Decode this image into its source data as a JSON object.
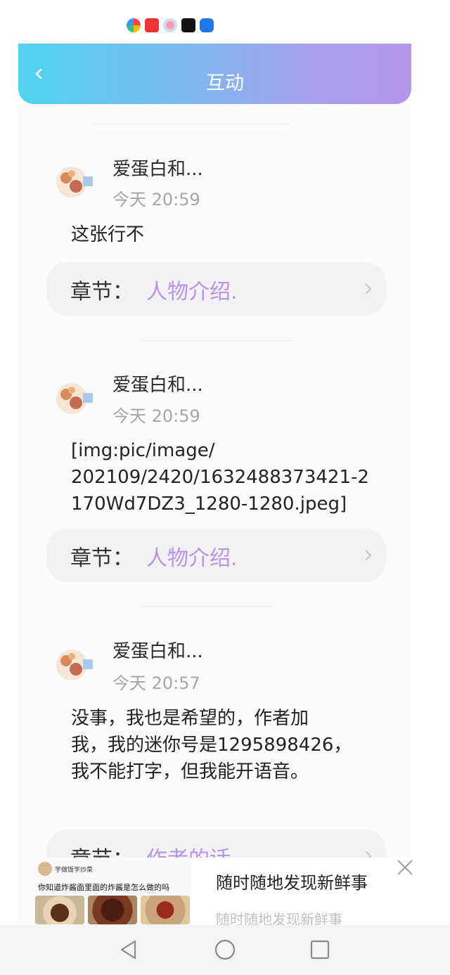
{
  "header": {
    "title": "互动"
  },
  "comments": [
    {
      "username": "爱蛋白和...",
      "time": "今天 20:59",
      "message": "这张行不",
      "chapter_label": "章节：",
      "chapter_name": "人物介绍."
    },
    {
      "username": "爱蛋白和...",
      "time": "今天 20:59",
      "message": "[img:pic/image/\n202109/2420/1632488373421-2\n170Wd7DZ3_1280-1280.jpeg]",
      "chapter_label": "章节：",
      "chapter_name": "人物介绍."
    },
    {
      "username": "爱蛋白和...",
      "time": "今天 20:57",
      "message": "没事，我也是希望的，作者加\n我，我的迷你号是1295898426，\n我不能打字，但我能开语音。",
      "chapter_label": "章节：",
      "chapter_name": "作者的话"
    }
  ],
  "ad": {
    "image_account": "学做饭学炒菜",
    "image_title": "你知道炸酱面里面的炸酱是怎么做的吗",
    "title": "随时随地发现新鲜事",
    "subtitle": "随时随地发现新鲜事"
  },
  "colors": {
    "accent_purple": "#b894e4",
    "header_cyan": "#4fd4f0",
    "header_purple": "#b496ea"
  }
}
